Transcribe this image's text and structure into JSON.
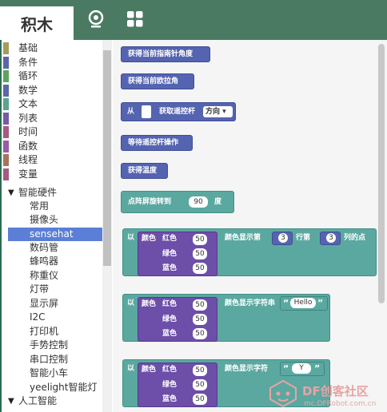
{
  "header": {
    "tab_label": "积木",
    "icons": [
      "webcam-icon",
      "extensions-grid-icon"
    ]
  },
  "sidebar": {
    "categories": [
      {
        "label": "基础",
        "color": "#a59b5f"
      },
      {
        "label": "条件",
        "color": "#5b67a6"
      },
      {
        "label": "循环",
        "color": "#5ba55b"
      },
      {
        "label": "数学",
        "color": "#5b67a6"
      },
      {
        "label": "文本",
        "color": "#5ba58c"
      },
      {
        "label": "列表",
        "color": "#745ba6"
      },
      {
        "label": "时间",
        "color": "#a55b80"
      },
      {
        "label": "函数",
        "color": "#995ba6"
      },
      {
        "label": "线程",
        "color": "#a5745b"
      },
      {
        "label": "变量",
        "color": "#a55b80"
      }
    ],
    "group1": "智能硬件",
    "items": [
      "常用",
      "摄像头",
      "sensehat",
      "数码管",
      "蜂鸣器",
      "称重仪",
      "灯带",
      "显示屏",
      "I2C",
      "打印机",
      "手势控制",
      "串口控制",
      "智能小车",
      "yeelight智能灯"
    ],
    "selected": "sensehat",
    "group2": "人工智能",
    "next_partial": "…"
  },
  "workspace": {
    "b1": "获得当前指南针角度",
    "b2": "获得当前欧拉角",
    "b3": {
      "prefix": "从",
      "text": "获取遥控杆",
      "dropdown": "方向 ▾"
    },
    "b4": "等待遥控杆操作",
    "b5": "获得温度",
    "b6": {
      "text": "点阵屏旋转到",
      "value": "90",
      "suffix": "度"
    },
    "b7": {
      "prefix": "以",
      "color_label": "颜色",
      "red": "红色",
      "green": "绿色",
      "blue": "蓝色",
      "r": "50",
      "g": "50",
      "b": "50",
      "text1": "颜色显示第",
      "row_val": "3",
      "row": "行第",
      "col_val": "3",
      "col": "列的点"
    },
    "b8": {
      "prefix": "以",
      "color_label": "颜色",
      "red": "红色",
      "green": "绿色",
      "blue": "蓝色",
      "r": "50",
      "g": "50",
      "b": "50",
      "text1": "颜色显示字符串",
      "open_q": "“",
      "string": "Hello",
      "close_q": "”"
    },
    "b9": {
      "prefix": "以",
      "color_label": "颜色",
      "red": "红色",
      "green": "绿色",
      "blue": "蓝色",
      "r": "50",
      "g": "50",
      "b": "50",
      "text1": "颜色显示字符",
      "open_q": "“",
      "char": "Y",
      "close_q": "”"
    }
  },
  "watermark": {
    "brand": "DF创客社区",
    "url": "mc.DFRobot.com.cn"
  }
}
